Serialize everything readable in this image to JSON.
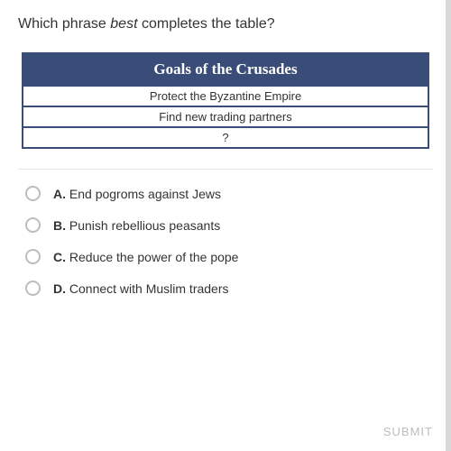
{
  "question": {
    "pre": "Which phrase ",
    "emph": "best",
    "post": " completes the table?"
  },
  "table": {
    "title": "Goals of the Crusades",
    "rows": [
      "Protect the Byzantine Empire",
      "Find new trading partners",
      "?"
    ]
  },
  "choices": [
    {
      "letter": "A.",
      "text": "End pogroms against Jews"
    },
    {
      "letter": "B.",
      "text": "Punish rebellious peasants"
    },
    {
      "letter": "C.",
      "text": "Reduce the power of the pope"
    },
    {
      "letter": "D.",
      "text": "Connect with Muslim traders"
    }
  ],
  "submit_label": "SUBMIT"
}
